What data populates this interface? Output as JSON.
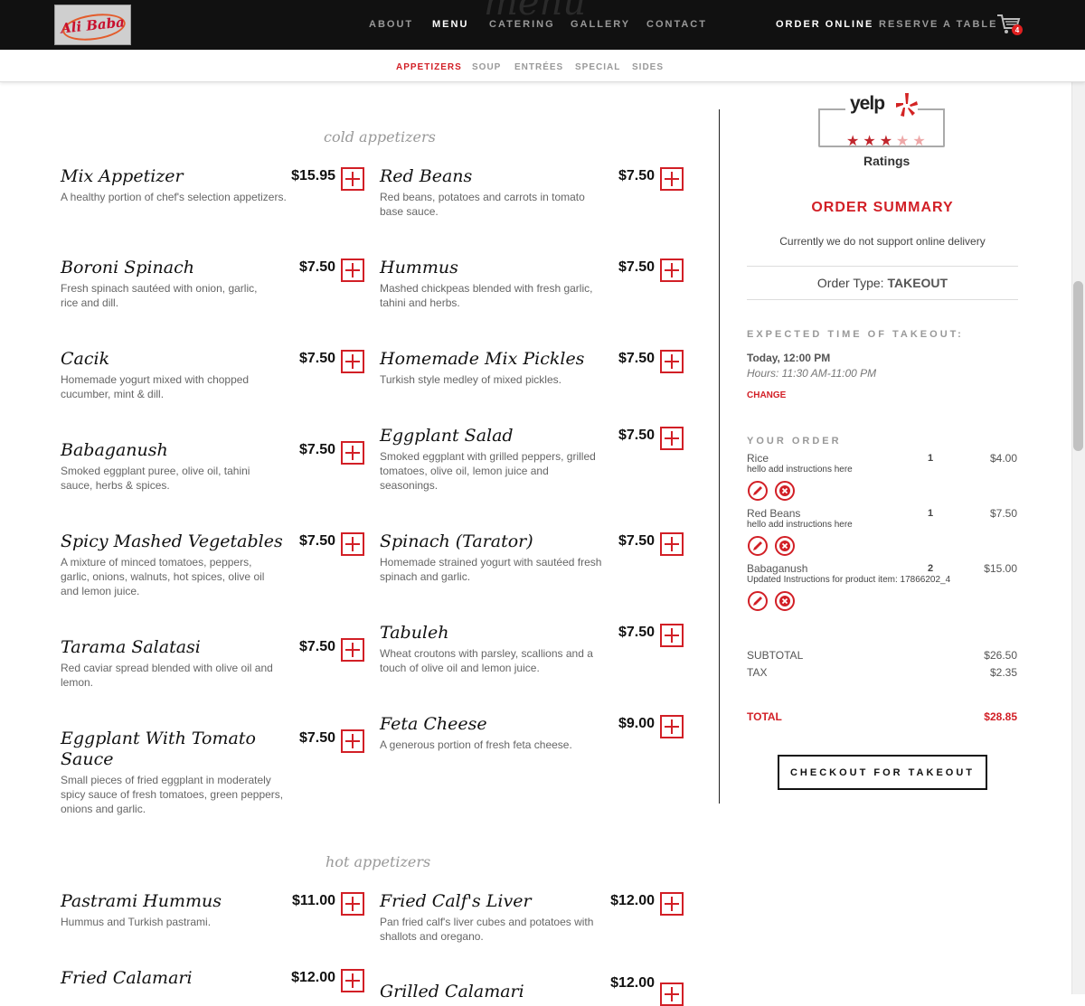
{
  "header": {
    "logo_text": "Ali Baba",
    "ghost_title": "menu",
    "nav": [
      {
        "label": "ABOUT",
        "active": false
      },
      {
        "label": "MENU",
        "active": true
      },
      {
        "label": "CATERING",
        "active": false
      },
      {
        "label": "GALLERY",
        "active": false
      },
      {
        "label": "CONTACT",
        "active": false
      }
    ],
    "order_online": "ORDER ONLINE",
    "reserve": "RESERVE A TABLE",
    "cart_count": "4"
  },
  "subnav": [
    {
      "label": "APPETIZERS",
      "active": true
    },
    {
      "label": "SOUP",
      "active": false
    },
    {
      "label": "ENTRÉES",
      "active": false
    },
    {
      "label": "SPECIAL",
      "active": false
    },
    {
      "label": "SIDES",
      "active": false
    }
  ],
  "sections": [
    {
      "title": "cold appetizers"
    },
    {
      "title": "hot appetizers"
    }
  ],
  "items": [
    {
      "name": "Mix Appetizer",
      "price": "$15.95",
      "desc": "A healthy portion of chef's selection appetizers."
    },
    {
      "name": "Red Beans",
      "price": "$7.50",
      "desc": "Red beans, potatoes and carrots in tomato base sauce."
    },
    {
      "name": "Boroni Spinach",
      "price": "$7.50",
      "desc": "Fresh spinach sautéed with onion, garlic, rice and dill."
    },
    {
      "name": "Hummus",
      "price": "$7.50",
      "desc": "Mashed chickpeas blended with fresh garlic, tahini and herbs."
    },
    {
      "name": "Cacik",
      "price": "$7.50",
      "desc": "Homemade yogurt mixed with chopped cucumber, mint & dill."
    },
    {
      "name": "Homemade Mix Pickles",
      "price": "$7.50",
      "desc": "Turkish style medley of mixed pickles."
    },
    {
      "name": "Babaganush",
      "price": "$7.50",
      "desc": "Smoked eggplant puree, olive oil, tahini sauce, herbs & spices."
    },
    {
      "name": "Eggplant Salad",
      "price": "$7.50",
      "desc": "Smoked eggplant with grilled peppers, grilled tomatoes, olive oil, lemon juice and seasonings."
    },
    {
      "name": "Spicy Mashed Vegetables",
      "price": "$7.50",
      "desc": "A mixture of minced tomatoes, peppers, garlic, onions, walnuts, hot spices, olive oil and lemon juice."
    },
    {
      "name": "Spinach (Tarator)",
      "price": "$7.50",
      "desc": "Homemade strained yogurt with sautéed fresh spinach and garlic."
    },
    {
      "name": "Tarama Salatasi",
      "price": "$7.50",
      "desc": "Red caviar spread blended with olive oil and lemon."
    },
    {
      "name": "Tabuleh",
      "price": "$7.50",
      "desc": "Wheat croutons with parsley, scallions and a touch of olive oil and lemon juice."
    },
    {
      "name": "Eggplant With Tomato Sauce",
      "price": "$7.50",
      "desc": "Small pieces of fried eggplant in moderately spicy sauce of fresh tomatoes, green peppers, onions and garlic."
    },
    {
      "name": "Feta Cheese",
      "price": "$9.00",
      "desc": "A generous portion of fresh feta cheese."
    },
    {
      "name": "Pastrami Hummus",
      "price": "$11.00",
      "desc": "Hummus and Turkish pastrami."
    },
    {
      "name": "Fried Calf's Liver",
      "price": "$12.00",
      "desc": "Pan fried calf's liver cubes and potatoes with shallots and oregano."
    },
    {
      "name": "Fried Calamari",
      "price": "$12.00",
      "desc": ""
    },
    {
      "name": "Grilled Calamari",
      "price": "$12.00",
      "desc": ""
    }
  ],
  "yelp": {
    "logo": "yelp",
    "rating": 3,
    "max": 5,
    "label": "Ratings"
  },
  "summary": {
    "title": "ORDER SUMMARY",
    "note": "Currently we do not support online delivery",
    "order_type_label": "Order Type:",
    "order_type_value": "TAKEOUT",
    "expected_label": "EXPECTED TIME OF TAKEOUT:",
    "time": "Today, 12:00 PM",
    "hours": "Hours: 11:30 AM-11:00 PM",
    "change": "CHANGE",
    "your_order": "YOUR ORDER",
    "order_items": [
      {
        "name": "Rice",
        "note": "hello add instructions here",
        "qty": "1",
        "price": "$4.00"
      },
      {
        "name": "Red Beans",
        "note": "hello add instructions here",
        "qty": "1",
        "price": "$7.50"
      },
      {
        "name": "Babaganush",
        "note": "Updated Instructions for product item: 17866202_4",
        "qty": "2",
        "price": "$15.00"
      }
    ],
    "subtotal_label": "SUBTOTAL",
    "subtotal": "$26.50",
    "tax_label": "TAX",
    "tax": "$2.35",
    "total_label": "TOTAL",
    "total": "$28.85",
    "checkout": "CHECKOUT FOR TAKEOUT"
  },
  "colors": {
    "accent": "#d21f26",
    "header_bg": "#111111"
  }
}
